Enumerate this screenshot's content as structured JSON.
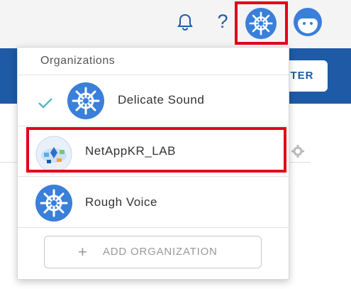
{
  "header": {
    "help_label": "?",
    "cta_label": "TER",
    "icons": {
      "notifications": "bell-icon",
      "organization": "kubernetes-helm-icon",
      "user": "user-avatar-icon"
    }
  },
  "dropdown": {
    "title": "Organizations",
    "organizations": [
      {
        "name": "Delicate Sound",
        "selected": true,
        "icon": "kubernetes-helm-icon"
      },
      {
        "name": "NetAppKR_LAB",
        "selected": false,
        "icon": "netapp-cloud-icon"
      },
      {
        "name": "Rough Voice",
        "selected": false,
        "icon": "kubernetes-helm-icon"
      }
    ],
    "add_button_label": "ADD ORGANIZATION",
    "add_button_icon": "plus-icon"
  },
  "colors": {
    "brand_blue": "#1e5aa6",
    "icon_blue": "#3a7fd9",
    "highlight_red": "#e2001a",
    "check_teal": "#5ab6c8"
  }
}
